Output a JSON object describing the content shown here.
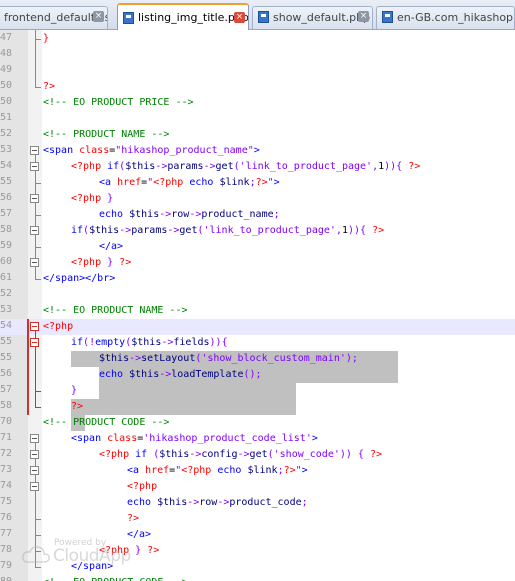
{
  "tabs": [
    {
      "label": "frontend_default.css",
      "active": false
    },
    {
      "label": "listing_img_title.php",
      "active": true
    },
    {
      "label": "show_default.php",
      "active": false
    },
    {
      "label": "en-GB.com_hikashop.ini",
      "active": false
    }
  ],
  "tab_close_glyph": "⊠",
  "colors": {
    "comment": "#008000",
    "tag": "#0000ff",
    "attribute": "#ff0000",
    "string": "#8000ff",
    "php_delimiter": "#ff0000",
    "selection": "#c0c0c0",
    "current_line": "#e8e8ff",
    "change_marker": "#d0302a"
  },
  "lines": [
    {
      "num": "47",
      "indent": 0,
      "tokens": [
        [
          "php",
          "}"
        ]
      ]
    },
    {
      "num": "48",
      "indent": 0,
      "tokens": []
    },
    {
      "num": "49",
      "indent": 0,
      "tokens": []
    },
    {
      "num": "50",
      "indent": 0,
      "tokens": [
        [
          "php",
          "?>"
        ]
      ]
    },
    {
      "num": "50",
      "indent": 0,
      "tokens": [
        [
          "cmt",
          "<!-- EO PRODUCT PRICE -->"
        ]
      ]
    },
    {
      "num": "51",
      "indent": 0,
      "tokens": []
    },
    {
      "num": "52",
      "indent": 0,
      "tokens": [
        [
          "cmt",
          "<!-- PRODUCT NAME -->"
        ]
      ]
    },
    {
      "num": "53",
      "indent": 0,
      "tokens": [
        [
          "tag",
          "<span "
        ],
        [
          "attr",
          "class"
        ],
        [
          "plain",
          "="
        ],
        [
          "str",
          "\"hikashop_product_name\""
        ],
        [
          "tag",
          ">"
        ]
      ]
    },
    {
      "num": "54",
      "indent": 1,
      "tokens": [
        [
          "php",
          "<?php "
        ],
        [
          "kw",
          "if"
        ],
        [
          "op",
          "("
        ],
        [
          "var",
          "$this"
        ],
        [
          "op",
          "->"
        ],
        [
          "fn",
          "params"
        ],
        [
          "op",
          "->"
        ],
        [
          "fn",
          "get"
        ],
        [
          "op",
          "("
        ],
        [
          "str",
          "'link_to_product_page'"
        ],
        [
          "op",
          ","
        ],
        [
          "plain",
          "1"
        ],
        [
          "op",
          ")){"
        ],
        [
          "php",
          " ?>"
        ]
      ]
    },
    {
      "num": "55",
      "indent": 2,
      "tokens": [
        [
          "tag",
          "<a "
        ],
        [
          "attr",
          "href"
        ],
        [
          "plain",
          "="
        ],
        [
          "str",
          "\""
        ],
        [
          "php",
          "<?php "
        ],
        [
          "kw",
          "echo "
        ],
        [
          "var",
          "$link"
        ],
        [
          "op",
          ";"
        ],
        [
          "php",
          "?>"
        ],
        [
          "str",
          "\""
        ],
        [
          "tag",
          ">"
        ]
      ]
    },
    {
      "num": "56",
      "indent": 1,
      "tokens": [
        [
          "php",
          "<?php "
        ],
        [
          "op",
          "}"
        ]
      ]
    },
    {
      "num": "57",
      "indent": 2,
      "tokens": [
        [
          "kw",
          "echo "
        ],
        [
          "var",
          "$this"
        ],
        [
          "op",
          "->"
        ],
        [
          "fn",
          "row"
        ],
        [
          "op",
          "->"
        ],
        [
          "fn",
          "product_name"
        ],
        [
          "op",
          ";"
        ]
      ]
    },
    {
      "num": "58",
      "indent": 1,
      "tokens": [
        [
          "kw",
          "if"
        ],
        [
          "op",
          "("
        ],
        [
          "var",
          "$this"
        ],
        [
          "op",
          "->"
        ],
        [
          "fn",
          "params"
        ],
        [
          "op",
          "->"
        ],
        [
          "fn",
          "get"
        ],
        [
          "op",
          "("
        ],
        [
          "str",
          "'link_to_product_page'"
        ],
        [
          "op",
          ","
        ],
        [
          "plain",
          "1"
        ],
        [
          "op",
          ")){"
        ],
        [
          "php",
          " ?>"
        ]
      ]
    },
    {
      "num": "59",
      "indent": 2,
      "tokens": [
        [
          "tag",
          "</a>"
        ]
      ]
    },
    {
      "num": "60",
      "indent": 1,
      "tokens": [
        [
          "php",
          "<?php "
        ],
        [
          "op",
          "}"
        ],
        [
          "php",
          " ?>"
        ]
      ]
    },
    {
      "num": "61",
      "indent": 0,
      "tokens": [
        [
          "tag",
          "</span></br>"
        ]
      ]
    },
    {
      "num": "52",
      "indent": 0,
      "tokens": []
    },
    {
      "num": "53",
      "indent": 0,
      "tokens": [
        [
          "cmt",
          "<!-- EO PRODUCT NAME -->"
        ]
      ]
    },
    {
      "num": "54",
      "indent": 0,
      "tokens": [
        [
          "php",
          "<?php"
        ]
      ]
    },
    {
      "num": "55",
      "indent": 1,
      "tokens": [
        [
          "kw",
          "if"
        ],
        [
          "op",
          "(!"
        ],
        [
          "kw",
          "empty"
        ],
        [
          "op",
          "("
        ],
        [
          "var",
          "$this"
        ],
        [
          "op",
          "->"
        ],
        [
          "fn",
          "fields"
        ],
        [
          "op",
          "))"
        ],
        [
          "op",
          "{"
        ]
      ]
    },
    {
      "num": "55",
      "indent": 2,
      "tokens": [
        [
          "var",
          "$this"
        ],
        [
          "op",
          "->"
        ],
        [
          "fn",
          "setLayout"
        ],
        [
          "op",
          "("
        ],
        [
          "str",
          "'show_block_custom_main'"
        ],
        [
          "op",
          ");"
        ]
      ]
    },
    {
      "num": "56",
      "indent": 2,
      "tokens": [
        [
          "kw",
          "echo "
        ],
        [
          "var",
          "$this"
        ],
        [
          "op",
          "->"
        ],
        [
          "fn",
          "loadTemplate"
        ],
        [
          "op",
          "();"
        ]
      ]
    },
    {
      "num": "57",
      "indent": 1,
      "tokens": [
        [
          "op",
          "}"
        ]
      ]
    },
    {
      "num": "58",
      "indent": 1,
      "tokens": [
        [
          "php",
          "?>"
        ]
      ]
    },
    {
      "num": "70",
      "indent": 0,
      "tokens": [
        [
          "cmt",
          "<!-- PRODUCT CODE -->"
        ]
      ]
    },
    {
      "num": "71",
      "indent": 1,
      "tokens": [
        [
          "tag",
          "<span "
        ],
        [
          "attr",
          "class"
        ],
        [
          "plain",
          "="
        ],
        [
          "str",
          "'hikashop_product_code_list'"
        ],
        [
          "tag",
          ">"
        ]
      ]
    },
    {
      "num": "72",
      "indent": 2,
      "tokens": [
        [
          "php",
          "<?php "
        ],
        [
          "kw",
          "if "
        ],
        [
          "op",
          "("
        ],
        [
          "var",
          "$this"
        ],
        [
          "op",
          "->"
        ],
        [
          "fn",
          "config"
        ],
        [
          "op",
          "->"
        ],
        [
          "fn",
          "get"
        ],
        [
          "op",
          "("
        ],
        [
          "str",
          "'show_code'"
        ],
        [
          "op",
          ")) {"
        ],
        [
          "php",
          " ?>"
        ]
      ]
    },
    {
      "num": "73",
      "indent": 3,
      "tokens": [
        [
          "tag",
          "<a "
        ],
        [
          "attr",
          "href"
        ],
        [
          "plain",
          "="
        ],
        [
          "str",
          "\""
        ],
        [
          "php",
          "<?php "
        ],
        [
          "kw",
          "echo "
        ],
        [
          "var",
          "$link"
        ],
        [
          "op",
          ";"
        ],
        [
          "php",
          "?>"
        ],
        [
          "str",
          "\""
        ],
        [
          "tag",
          ">"
        ]
      ]
    },
    {
      "num": "74",
      "indent": 3,
      "tokens": [
        [
          "php",
          "<?php"
        ]
      ]
    },
    {
      "num": "75",
      "indent": 3,
      "tokens": [
        [
          "kw",
          "echo "
        ],
        [
          "var",
          "$this"
        ],
        [
          "op",
          "->"
        ],
        [
          "fn",
          "row"
        ],
        [
          "op",
          "->"
        ],
        [
          "fn",
          "product_code"
        ],
        [
          "op",
          ";"
        ]
      ]
    },
    {
      "num": "76",
      "indent": 3,
      "tokens": [
        [
          "php",
          "?>"
        ]
      ]
    },
    {
      "num": "77",
      "indent": 3,
      "tokens": [
        [
          "tag",
          "</a>"
        ]
      ]
    },
    {
      "num": "78",
      "indent": 2,
      "tokens": [
        [
          "php",
          "<?php "
        ],
        [
          "op",
          "}"
        ],
        [
          "php",
          " ?>"
        ]
      ]
    },
    {
      "num": "79",
      "indent": 1,
      "tokens": [
        [
          "tag",
          "</span>"
        ]
      ]
    },
    {
      "num": "80",
      "indent": 0,
      "tokens": [
        [
          "cmt",
          "<!-- EO PRODUCT CODE -->"
        ]
      ]
    }
  ],
  "watermark": {
    "small": "Powered by",
    "big": "CloudApp"
  }
}
